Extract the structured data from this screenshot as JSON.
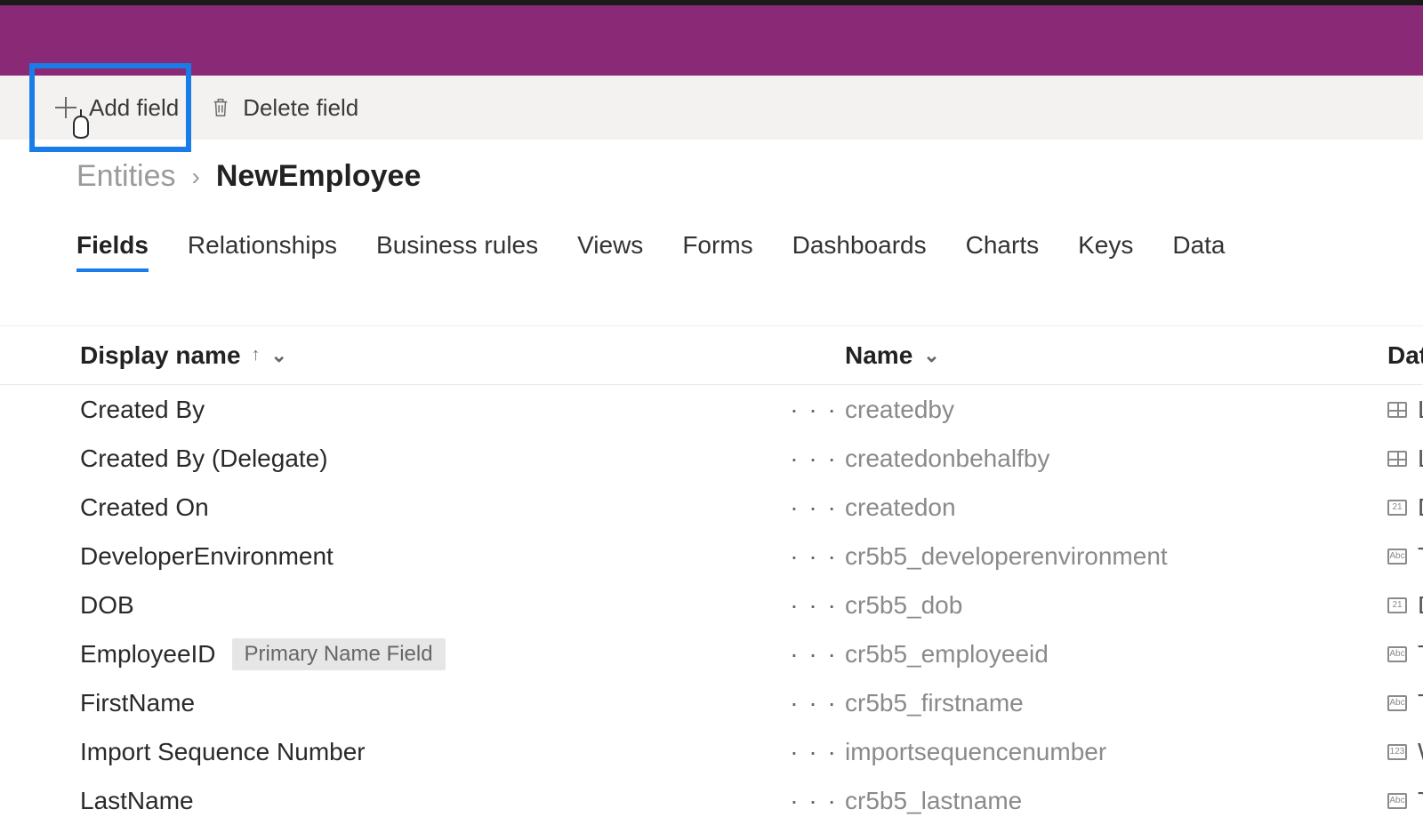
{
  "toolbar": {
    "add_field_label": "Add field",
    "delete_field_label": "Delete field"
  },
  "breadcrumb": {
    "root": "Entities",
    "current": "NewEmployee"
  },
  "tabs": {
    "items": [
      {
        "label": "Fields",
        "active": true
      },
      {
        "label": "Relationships"
      },
      {
        "label": "Business rules"
      },
      {
        "label": "Views"
      },
      {
        "label": "Forms"
      },
      {
        "label": "Dashboards"
      },
      {
        "label": "Charts"
      },
      {
        "label": "Keys"
      },
      {
        "label": "Data"
      }
    ]
  },
  "columns": {
    "display_name": "Display name",
    "name": "Name",
    "data_type": "Data type"
  },
  "rows": [
    {
      "display": "Created By",
      "name": "createdby",
      "type": "Lookup",
      "type_icon": "grid"
    },
    {
      "display": "Created By (Delegate)",
      "name": "createdonbehalfby",
      "type": "Lookup",
      "type_icon": "grid"
    },
    {
      "display": "Created On",
      "name": "createdon",
      "type": "Date a",
      "type_icon": "date"
    },
    {
      "display": "DeveloperEnvironment",
      "name": "cr5b5_developerenvironment",
      "type": "Text",
      "type_icon": "text"
    },
    {
      "display": "DOB",
      "name": "cr5b5_dob",
      "type": "Date O",
      "type_icon": "date"
    },
    {
      "display": "EmployeeID",
      "name": "cr5b5_employeeid",
      "type": "Text",
      "type_icon": "text",
      "badge": "Primary Name Field"
    },
    {
      "display": "FirstName",
      "name": "cr5b5_firstname",
      "type": "Text",
      "type_icon": "text"
    },
    {
      "display": "Import Sequence Number",
      "name": "importsequencenumber",
      "type": "Whole",
      "type_icon": "num"
    },
    {
      "display": "LastName",
      "name": "cr5b5_lastname",
      "type": "Text",
      "type_icon": "text"
    }
  ],
  "badge_label": "Primary Name Field"
}
